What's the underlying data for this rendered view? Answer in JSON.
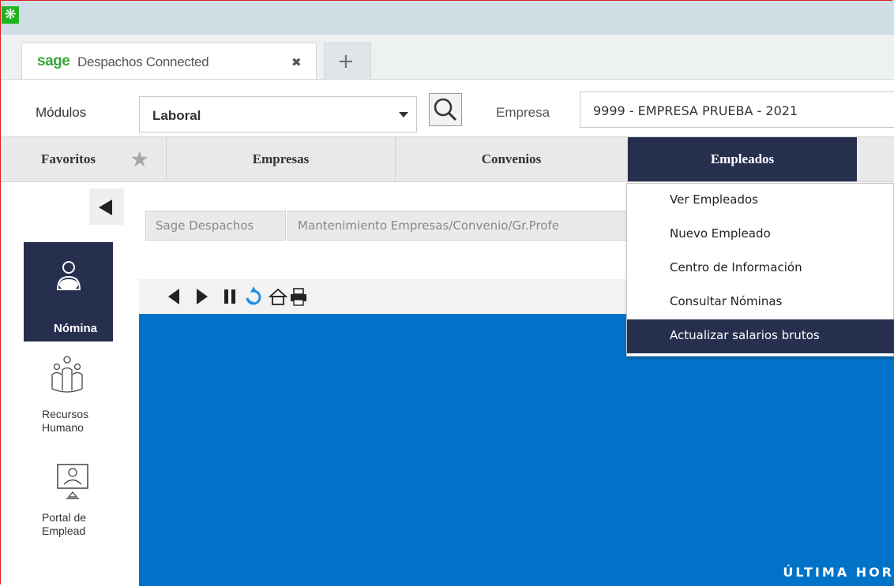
{
  "window": {
    "app_icon": "app-logo-icon"
  },
  "tabs": {
    "active": {
      "logo": "sage",
      "title": "Despachos Connected",
      "close": "✖"
    },
    "new_tab": "+"
  },
  "toolbar": {
    "modules_label": "Módulos",
    "modules_value": "Laboral",
    "company_label": "Empresa",
    "company_value": "9999 - EMPRESA PRUEBA - 2021"
  },
  "menu": {
    "favoritos": "Favoritos",
    "empresas": "Empresas",
    "convenios": "Convenios",
    "empleados": "Empleados"
  },
  "sidebar": {
    "items": [
      {
        "label": "Nómina",
        "icon": "person-icon",
        "selected": true
      },
      {
        "label": "Recursos Humano",
        "icon": "people-group-icon"
      },
      {
        "label": "Portal de Emplead",
        "icon": "portal-icon"
      }
    ]
  },
  "breadcrumbs": [
    "Sage Despachos",
    "Mantenimiento Empresas/Convenio/Gr.Profe"
  ],
  "content": {
    "banner": "ÚLTIMA HOR"
  },
  "dropdown": {
    "items": [
      "Ver Empleados",
      "Nuevo Empleado",
      "Centro de Información",
      "Consultar Nóminas",
      "Actualizar salarios brutos"
    ],
    "selected_index": 4
  },
  "colors": {
    "navy": "#26304e",
    "blue": "#0073c8",
    "sage_green": "#3aa53a"
  }
}
